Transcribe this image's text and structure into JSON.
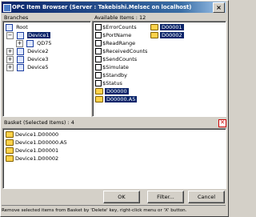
{
  "window": {
    "title": "OPC Item Browser (Server : Takebishi.Melsec on localhost)"
  },
  "branches": {
    "label": "Branches",
    "items": [
      {
        "label": "Root"
      },
      {
        "label": "Device1"
      },
      {
        "label": "QD75"
      },
      {
        "label": "Device2"
      },
      {
        "label": "Device3"
      },
      {
        "label": "Device5"
      }
    ]
  },
  "available": {
    "label": "Available Items : 12",
    "items": [
      {
        "label": "$ErrorCounts"
      },
      {
        "label": "$PortName"
      },
      {
        "label": "$ReadRange"
      },
      {
        "label": "$ReceivedCounts"
      },
      {
        "label": "$SendCounts"
      },
      {
        "label": "$Simulate"
      },
      {
        "label": "$Standby"
      },
      {
        "label": "$Status"
      },
      {
        "label": "D00000"
      },
      {
        "label": "D00000.A5"
      },
      {
        "label": "D00001"
      },
      {
        "label": "D00002"
      }
    ]
  },
  "basket": {
    "label": "Basket (Selected Items) : 4",
    "items": [
      {
        "label": "Device1.D00000"
      },
      {
        "label": "Device1.D00000.A5"
      },
      {
        "label": "Device1.D00001"
      },
      {
        "label": "Device1.D00002"
      }
    ]
  },
  "buttons": {
    "ok": "OK",
    "filter": "Filter...",
    "cancel": "Cancel"
  },
  "status": "Remove selected items from Basket by 'Delete' key, right-click menu or 'X' button.",
  "colors": {
    "selection": "#0a246a",
    "title_start": "#0a246a",
    "title_end": "#a6caf0"
  }
}
